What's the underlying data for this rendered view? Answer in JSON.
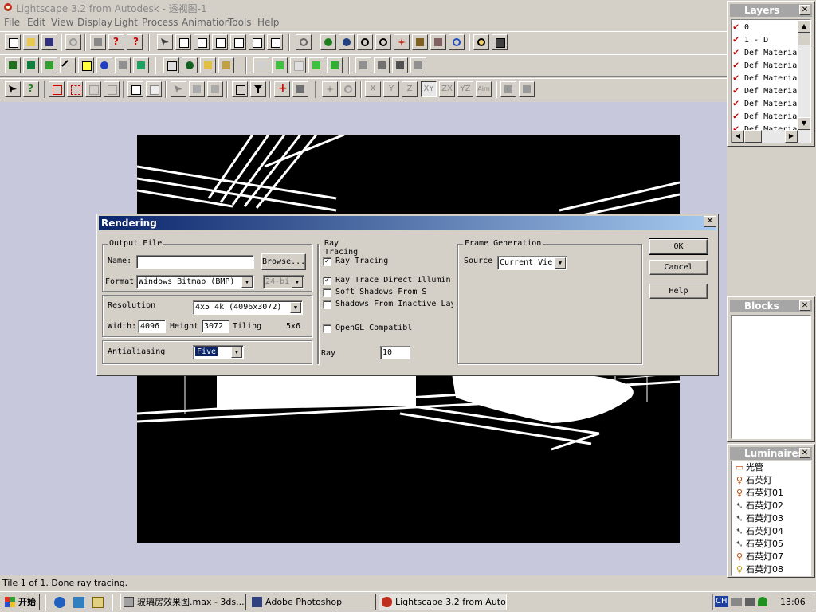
{
  "window": {
    "title": "Lightscape 3.2 from Autodesk - 透视图-1"
  },
  "menu": [
    "File",
    "Edit",
    "View",
    "Display",
    "Light",
    "Process",
    "Animation",
    "Tools",
    "Help"
  ],
  "toolbar3_labels": [
    "X",
    "Y",
    "Z",
    "XY",
    "ZX",
    "YZ",
    "Aim"
  ],
  "status": "Tile 1 of 1. Done ray tracing.",
  "layers": {
    "title": "Layers",
    "items": [
      "0",
      "1 - D",
      "Def Materia",
      "Def Materia",
      "Def Materia",
      "Def Materia",
      "Def Materia",
      "Def Materia",
      "Def Materia"
    ]
  },
  "blocks": {
    "title": "Blocks"
  },
  "luminaires": {
    "title": "Luminaires",
    "items": [
      "光管",
      "石英灯",
      "石英灯01",
      "石英灯02",
      "石英灯03",
      "石英灯04",
      "石英灯05",
      "石英灯07",
      "石英灯08"
    ]
  },
  "dialog": {
    "title": "Rendering",
    "output_file": {
      "label": "Output File",
      "name_label": "Name:",
      "name_value": "",
      "browse": "Browse...",
      "format_label": "Format",
      "format_value": "Windows Bitmap (BMP)",
      "bits_value": "24-bi"
    },
    "resolution": {
      "label": "Resolution",
      "value": "4x5 4k (4096x3072)",
      "width_label": "Width:",
      "width_value": "4096",
      "height_label": "Height",
      "height_value": "3072",
      "tiling_label": "Tiling",
      "tiling_value": "5x6"
    },
    "antialiasing": {
      "label": "Antialiasing",
      "value": "Five"
    },
    "ray_tracing": {
      "label": "Ray Tracing",
      "checks": [
        {
          "label": "Ray Tracing",
          "checked": true
        },
        {
          "label": "Ray Trace Direct Illumin",
          "checked": true
        },
        {
          "label": "Soft Shadows From S",
          "checked": false
        },
        {
          "label": "Shadows From Inactive Lay",
          "checked": false
        },
        {
          "label": "OpenGL Compatibl",
          "checked": false
        }
      ],
      "ray_label": "Ray",
      "ray_value": "10"
    },
    "frame_generation": {
      "label": "Frame Generation",
      "source_label": "Source",
      "source_value": "Current Vie"
    },
    "buttons": {
      "ok": "OK",
      "cancel": "Cancel",
      "help": "Help"
    }
  },
  "taskbar": {
    "start": "开始",
    "tasks": [
      "玻璃房效果图.max - 3ds...",
      "Adobe Photoshop",
      "Lightscape 3.2 from Auto..."
    ],
    "ime": "CH",
    "clock": "13:06"
  },
  "colors": {
    "title_active": "#0a246a",
    "workspace": "#c8c8dc",
    "check_red": "#cc0000"
  }
}
